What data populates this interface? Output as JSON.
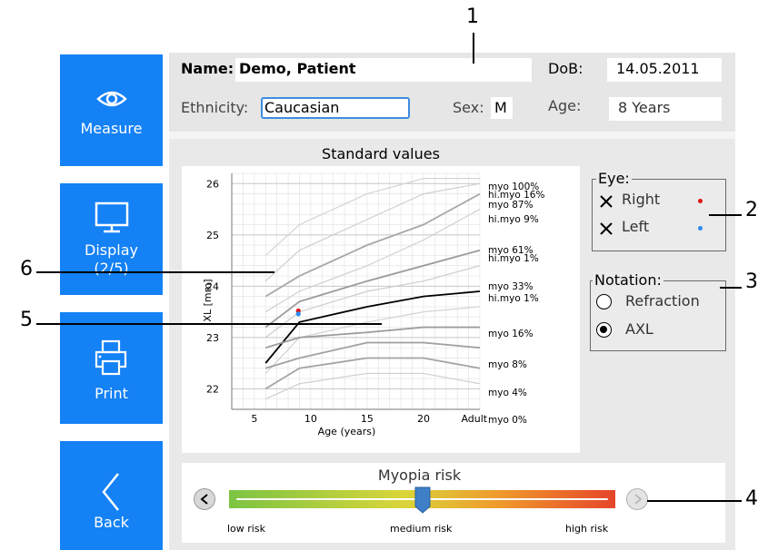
{
  "nav": {
    "measure": {
      "label": "Measure",
      "icon": "eye-icon"
    },
    "display": {
      "label": "Display",
      "sub": "(2/5)",
      "icon": "monitor-icon"
    },
    "print": {
      "label": "Print",
      "icon": "printer-icon"
    },
    "back": {
      "label": "Back",
      "icon": "chevron-left-icon"
    }
  },
  "patient": {
    "name_label": "Name:",
    "name_value": "Demo, Patient",
    "dob_label": "DoB:",
    "dob_value": "14.05.2011",
    "ethnicity_label": "Ethnicity:",
    "ethnicity_value": "Caucasian",
    "sex_label": "Sex:",
    "sex_value": "M",
    "age_label": "Age:",
    "age_value": "8 Years"
  },
  "standard_values": {
    "title": "Standard values"
  },
  "eye": {
    "title": "Eye:",
    "right_label": "Right",
    "left_label": "Left",
    "right_color": "#e01515",
    "left_color": "#2a8cf0"
  },
  "notation": {
    "title": "Notation:",
    "options": [
      "Refraction",
      "AXL"
    ],
    "selected": "AXL"
  },
  "myopia_risk": {
    "title": "Myopia risk",
    "low_label": "low risk",
    "medium_label": "medium risk",
    "high_label": "high risk",
    "level": 0.5
  },
  "callouts": [
    "1",
    "2",
    "3",
    "4",
    "5",
    "6"
  ],
  "chart_data": {
    "type": "line",
    "xlabel": "Age (years)",
    "ylabel": "XL [mm]",
    "x_ticks": [
      "5",
      "10",
      "15",
      "20",
      "Adult"
    ],
    "x": [
      6,
      9,
      15,
      20,
      25
    ],
    "xlim": [
      3,
      25
    ],
    "ylim": [
      21.6,
      26.2
    ],
    "y_ticks": [
      22,
      23,
      24,
      25,
      26
    ],
    "grid": true,
    "series": [
      {
        "name": "myo 100%",
        "values": [
          24.6,
          25.2,
          25.8,
          26.1,
          26.1
        ]
      },
      {
        "name": "hi.myo 16%",
        "values": [
          24.1,
          24.7,
          25.3,
          25.8,
          26.0
        ]
      },
      {
        "name": "myo 87%",
        "values": [
          23.8,
          24.2,
          24.8,
          25.2,
          25.8
        ]
      },
      {
        "name": "hi.myo 9%",
        "values": [
          23.5,
          23.9,
          24.4,
          24.9,
          25.5
        ]
      },
      {
        "name": "myo 61%",
        "values": [
          23.2,
          23.7,
          24.1,
          24.4,
          24.7
        ]
      },
      {
        "name": "hi.myo 1%",
        "values": [
          23.0,
          23.5,
          23.9,
          24.1,
          24.4
        ]
      },
      {
        "name": "myo 33%",
        "values": [
          22.5,
          23.3,
          23.6,
          23.8,
          23.9
        ]
      },
      {
        "name": "hi.myo 1%",
        "values": [
          22.3,
          23.0,
          23.3,
          23.5,
          23.6
        ]
      },
      {
        "name": "myo 16%",
        "values": [
          22.8,
          23.0,
          23.1,
          23.2,
          23.2
        ]
      },
      {
        "name": "myo 8%",
        "values": [
          22.4,
          22.6,
          22.9,
          22.9,
          22.8
        ]
      },
      {
        "name": "myo 4%",
        "values": [
          22.0,
          22.4,
          22.6,
          22.6,
          22.4
        ]
      },
      {
        "name": "myo 0%",
        "values": [
          21.8,
          22.1,
          22.3,
          22.3,
          22.1
        ]
      }
    ],
    "patient_points": [
      {
        "eye": "Right",
        "x": 8.9,
        "y": 23.52
      },
      {
        "eye": "Left",
        "x": 8.9,
        "y": 23.46
      }
    ]
  }
}
